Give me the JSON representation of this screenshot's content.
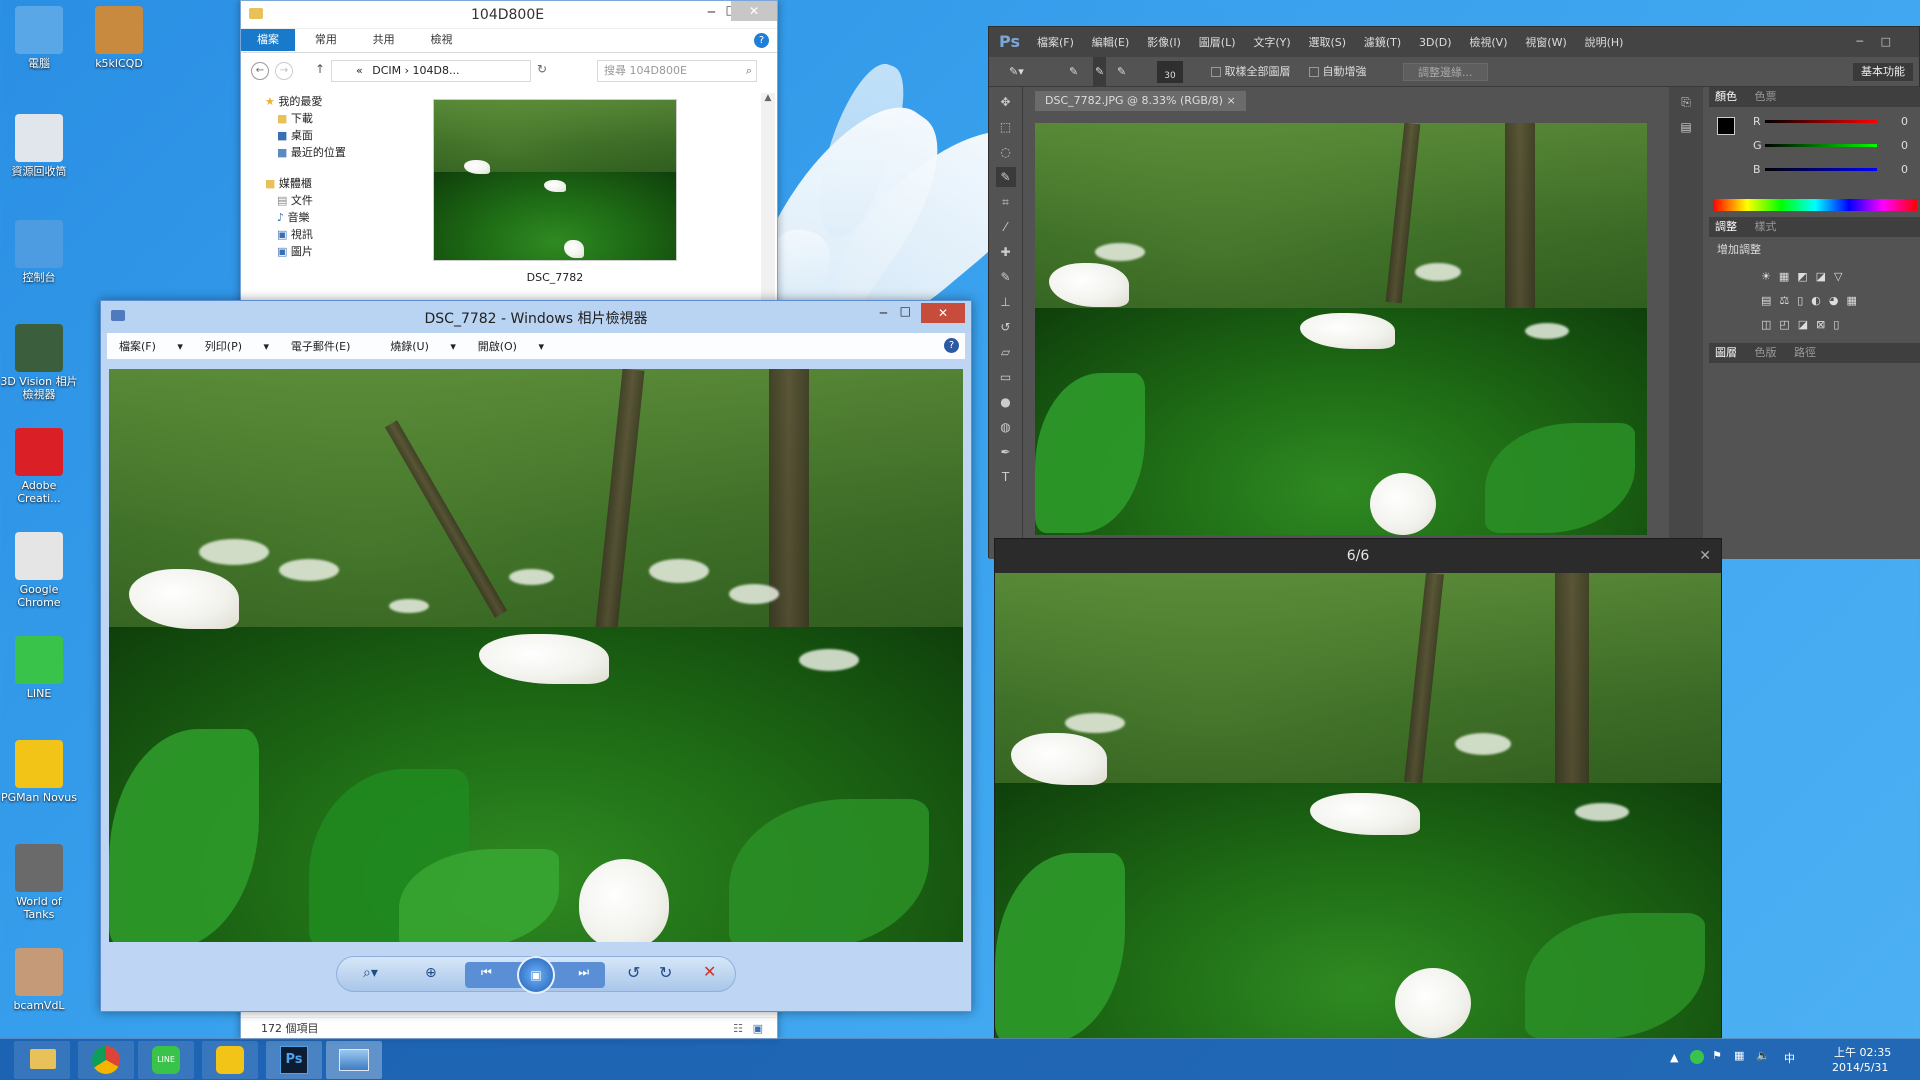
{
  "desktop": {
    "icons": [
      {
        "label": "電腦",
        "icon": "computer-icon",
        "color": "#5aa7e8"
      },
      {
        "label": "k5klCQD",
        "icon": "user-picture-icon",
        "color": "#c78a3e"
      },
      {
        "label": "資源回收筒",
        "icon": "recycle-bin-icon",
        "color": "#e0e6ec"
      },
      {
        "label": "控制台",
        "icon": "control-panel-icon",
        "color": "#4d9be0"
      },
      {
        "label": "3D Vision 相片檢視器",
        "icon": "3d-vision-icon",
        "color": "#3b5f3c"
      },
      {
        "label": "Adobe Creati...",
        "icon": "adobe-creative-cloud-icon",
        "color": "#da1f26"
      },
      {
        "label": "Google Chrome",
        "icon": "chrome-icon",
        "color": "#e5e5e5"
      },
      {
        "label": "LINE",
        "icon": "line-icon",
        "color": "#3ac34a"
      },
      {
        "label": "PGMan Novus",
        "icon": "pgman-icon",
        "color": "#f2c418"
      },
      {
        "label": "World of Tanks",
        "icon": "world-of-tanks-icon",
        "color": "#6a6a6a"
      },
      {
        "label": "bcamVdL",
        "icon": "bcam-icon",
        "color": "#c59a78"
      }
    ]
  },
  "explorer": {
    "title": "104D800E",
    "tabs": [
      "檔案",
      "常用",
      "共用",
      "檢視"
    ],
    "breadcrumb": [
      "«",
      "DCIM",
      "104D8..."
    ],
    "search_placeholder": "搜尋 104D800E",
    "nav": {
      "favorites": "我的最愛",
      "favorite_items": [
        "下載",
        "桌面",
        "最近的位置"
      ],
      "libraries": "媒體櫃",
      "library_items": [
        "文件",
        "音樂",
        "視訊",
        "圖片"
      ]
    },
    "file_label": "DSC_7782",
    "status": "172 個項目"
  },
  "photo_viewer": {
    "title": "DSC_7782 - Windows 相片檢視器",
    "menu": [
      "檔案(F)",
      "列印(P)",
      "電子郵件(E)",
      "燒錄(U)",
      "開啟(O)"
    ]
  },
  "photoshop": {
    "logo": "Ps",
    "menu": [
      "檔案(F)",
      "編輯(E)",
      "影像(I)",
      "圖層(L)",
      "文字(Y)",
      "選取(S)",
      "濾鏡(T)",
      "3D(D)",
      "檢視(V)",
      "視窗(W)",
      "說明(H)"
    ],
    "brush_size": "30",
    "options": [
      "取樣全部圖層",
      "自動增強"
    ],
    "refine_button": "調整邊緣...",
    "workspace": "基本功能",
    "doc_tab": "DSC_7782.JPG @ 8.33% (RGB/8)",
    "panels": {
      "color_tabs": [
        "顏色",
        "色票"
      ],
      "channels": [
        {
          "label": "R",
          "value": "0"
        },
        {
          "label": "G",
          "value": "0"
        },
        {
          "label": "B",
          "value": "0"
        }
      ],
      "adjust_tabs": [
        "調整",
        "樣式"
      ],
      "adjust_title": "增加調整",
      "layer_tabs": [
        "圖層",
        "色版",
        "路徑"
      ]
    }
  },
  "image_popup": {
    "counter": "6/6"
  },
  "taskbar": {
    "apps": [
      "file-explorer-icon",
      "chrome-icon",
      "line-icon",
      "pgman-icon",
      "photoshop-icon",
      "photo-viewer-icon"
    ],
    "ps_label": "Ps",
    "ime": "中",
    "time": "上午 02:35",
    "date": "2014/5/31"
  }
}
